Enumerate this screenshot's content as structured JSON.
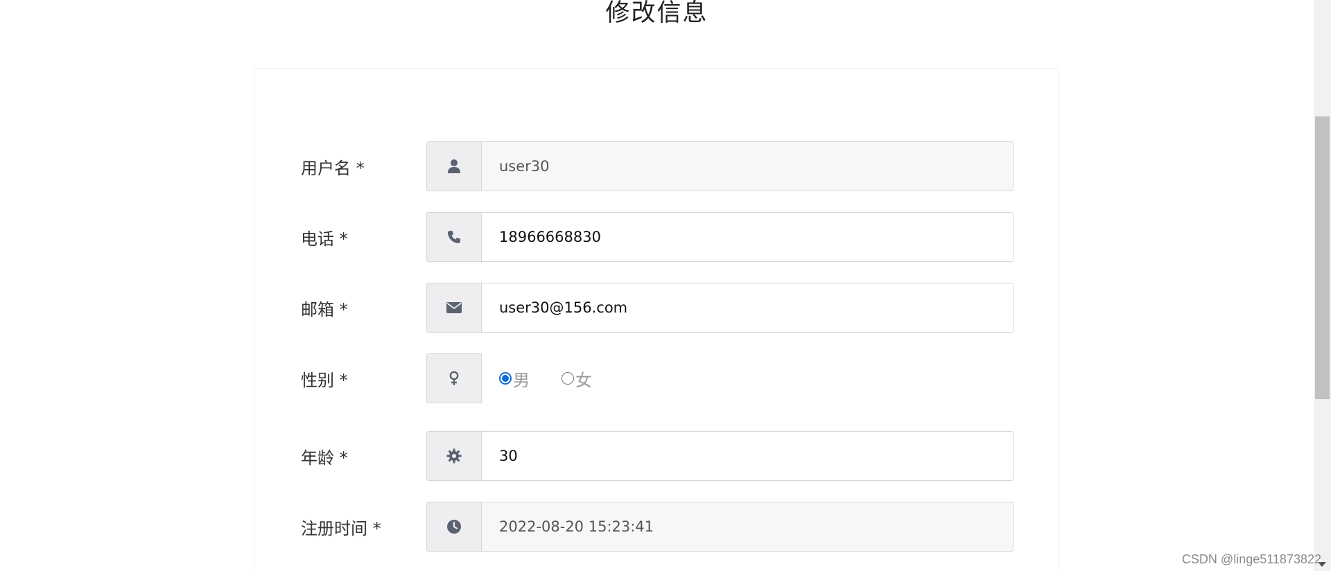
{
  "page": {
    "title": "修改信息"
  },
  "form": {
    "username": {
      "label": "用户名 *",
      "value": "user30",
      "icon": "user-icon"
    },
    "phone": {
      "label": "电话 *",
      "value": "18966668830",
      "icon": "phone-icon"
    },
    "email": {
      "label": "邮箱 *",
      "value": "user30@156.com",
      "icon": "envelope-icon"
    },
    "gender": {
      "label": "性别 *",
      "icon": "venus-icon",
      "options": [
        "男",
        "女"
      ],
      "selected": "男"
    },
    "age": {
      "label": "年龄 *",
      "value": "30",
      "icon": "gear-icon"
    },
    "register_time": {
      "label": "注册时间 *",
      "value": "2022-08-20 15:23:41",
      "icon": "clock-icon"
    }
  },
  "watermark": "CSDN @linge511873822",
  "colors": {
    "radio_checked": "#0b6bd6",
    "icon": "#5a6270",
    "addon_bg": "#eeeef0",
    "readonly_bg": "#f7f7f7"
  }
}
